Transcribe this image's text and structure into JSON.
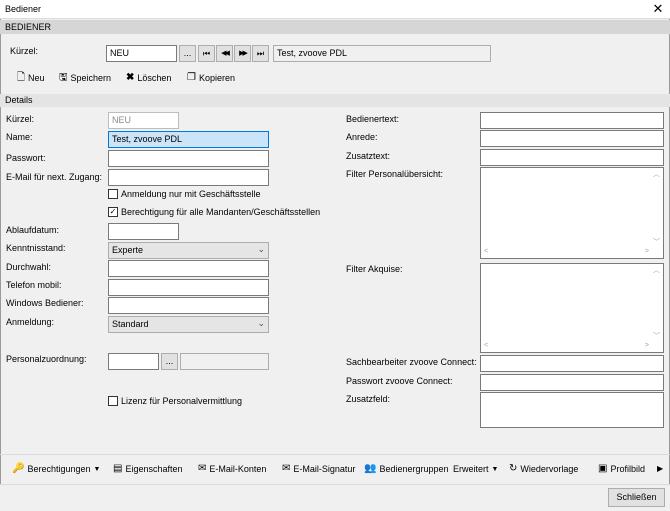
{
  "window": {
    "title": "Bediener",
    "close_glyph": "✕"
  },
  "section_header": "BEDIENER",
  "top": {
    "kuerzel_label": "Kürzel:",
    "kuerzel_value": "NEU",
    "browse_label": "...",
    "nav": {
      "first": "⏮",
      "prev": "◀◀",
      "next": "▶▶",
      "last": "⏭"
    },
    "name_display": "Test, zvoove PDL"
  },
  "actions": {
    "neu": "Neu",
    "speichern": "Speichern",
    "loeschen": "Löschen",
    "kopieren": "Kopieren"
  },
  "details_header": "Details",
  "left": {
    "kuerzel_label": "Kürzel:",
    "kuerzel_value": "NEU",
    "name_label": "Name:",
    "name_value": "Test, zvoove PDL",
    "passwort_label": "Passwort:",
    "email_label": "E-Mail für next. Zugang:",
    "chk_anmeldung_label": "Anmeldung nur mit Geschäftsstelle",
    "chk_anmeldung_checked": false,
    "chk_berechtigung_label": "Berechtigung für alle Mandanten/Geschäftsstellen",
    "chk_berechtigung_checked": true,
    "ablaufdatum_label": "Ablaufdatum:",
    "kenntnisstand_label": "Kenntnisstand:",
    "kenntnisstand_value": "Experte",
    "durchwahl_label": "Durchwahl:",
    "telefon_label": "Telefon mobil:",
    "windows_label": "Windows Bediener:",
    "anmeldung_label": "Anmeldung:",
    "anmeldung_value": "Standard",
    "personalzuordnung_label": "Personalzuordnung:",
    "personal_browse": "...",
    "chk_lizenz_label": "Lizenz für Personalvermittlung",
    "chk_lizenz_checked": false
  },
  "right": {
    "bedienertext_label": "Bedienertext:",
    "anrede_label": "Anrede:",
    "zusatztext_label": "Zusatztext:",
    "filter_personal_label": "Filter Personalübersicht:",
    "filter_akquise_label": "Filter Akquise:",
    "sachbearbeiter_label": "Sachbearbeiter zvoove Connect:",
    "passwort_connect_label": "Passwort zvoove Connect:",
    "zusatzfeld_label": "Zusatzfeld:"
  },
  "bottom_toolbar": {
    "berechtigungen": "Berechtigungen",
    "eigenschaften": "Eigenschaften",
    "email_konten": "E-Mail-Konten",
    "email_signatur": "E-Mail-Signatur",
    "bedienergruppen": "Bedienergruppen",
    "erweitert": "Erweitert",
    "wiedervorlage": "Wiedervorlage",
    "profilbild": "Profilbild",
    "more": "▶"
  },
  "close_button": "Schließen"
}
